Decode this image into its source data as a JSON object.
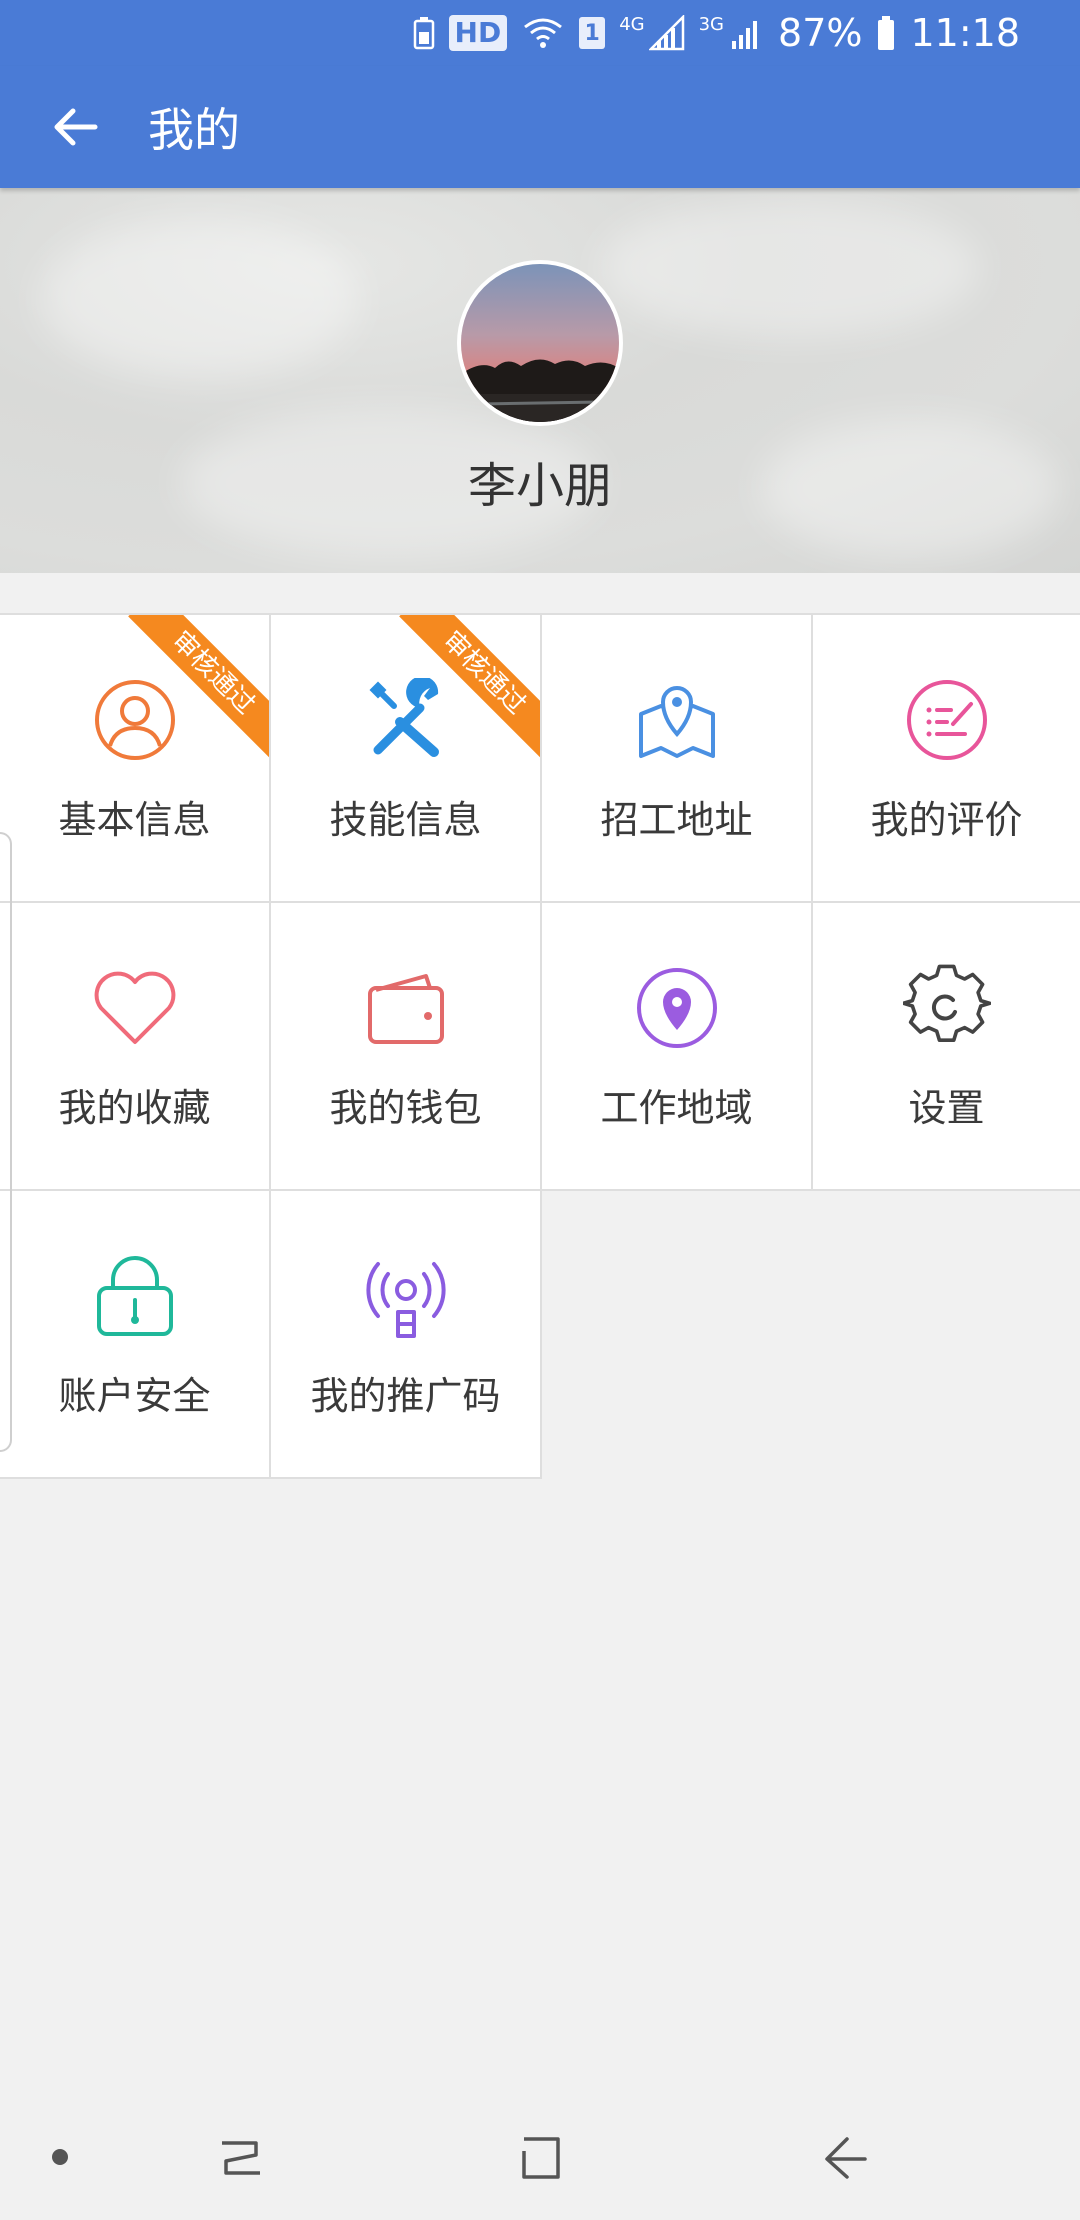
{
  "status_bar": {
    "hd": "HD",
    "sim": "1",
    "net1": "4G",
    "net2": "3G",
    "battery": "87%",
    "time": "11:18"
  },
  "app_bar": {
    "title": "我的"
  },
  "profile": {
    "name": "李小朋"
  },
  "grid": {
    "items": [
      {
        "label": "基本信息",
        "badge": "审核通过",
        "icon": "user-circle-icon",
        "color": "#f07a3a"
      },
      {
        "label": "技能信息",
        "badge": "审核通过",
        "icon": "tools-icon",
        "color": "#2a8fe0"
      },
      {
        "label": "招工地址",
        "icon": "map-pin-icon",
        "color": "#4a90e2"
      },
      {
        "label": "我的评价",
        "icon": "review-icon",
        "color": "#e8559a"
      },
      {
        "label": "我的收藏",
        "icon": "heart-icon",
        "color": "#f06b7a"
      },
      {
        "label": "我的钱包",
        "icon": "wallet-icon",
        "color": "#e26a6a"
      },
      {
        "label": "工作地域",
        "icon": "location-icon",
        "color": "#9b5ce0"
      },
      {
        "label": "设置",
        "icon": "gear-icon",
        "color": "#444444"
      },
      {
        "label": "账户安全",
        "icon": "lock-icon",
        "color": "#1fb89a"
      },
      {
        "label": "我的推广码",
        "icon": "broadcast-icon",
        "color": "#8a5ce0"
      }
    ]
  },
  "colors": {
    "primary": "#4a7bd6",
    "ribbon": "#f5891f",
    "background": "#f1f1f1"
  }
}
